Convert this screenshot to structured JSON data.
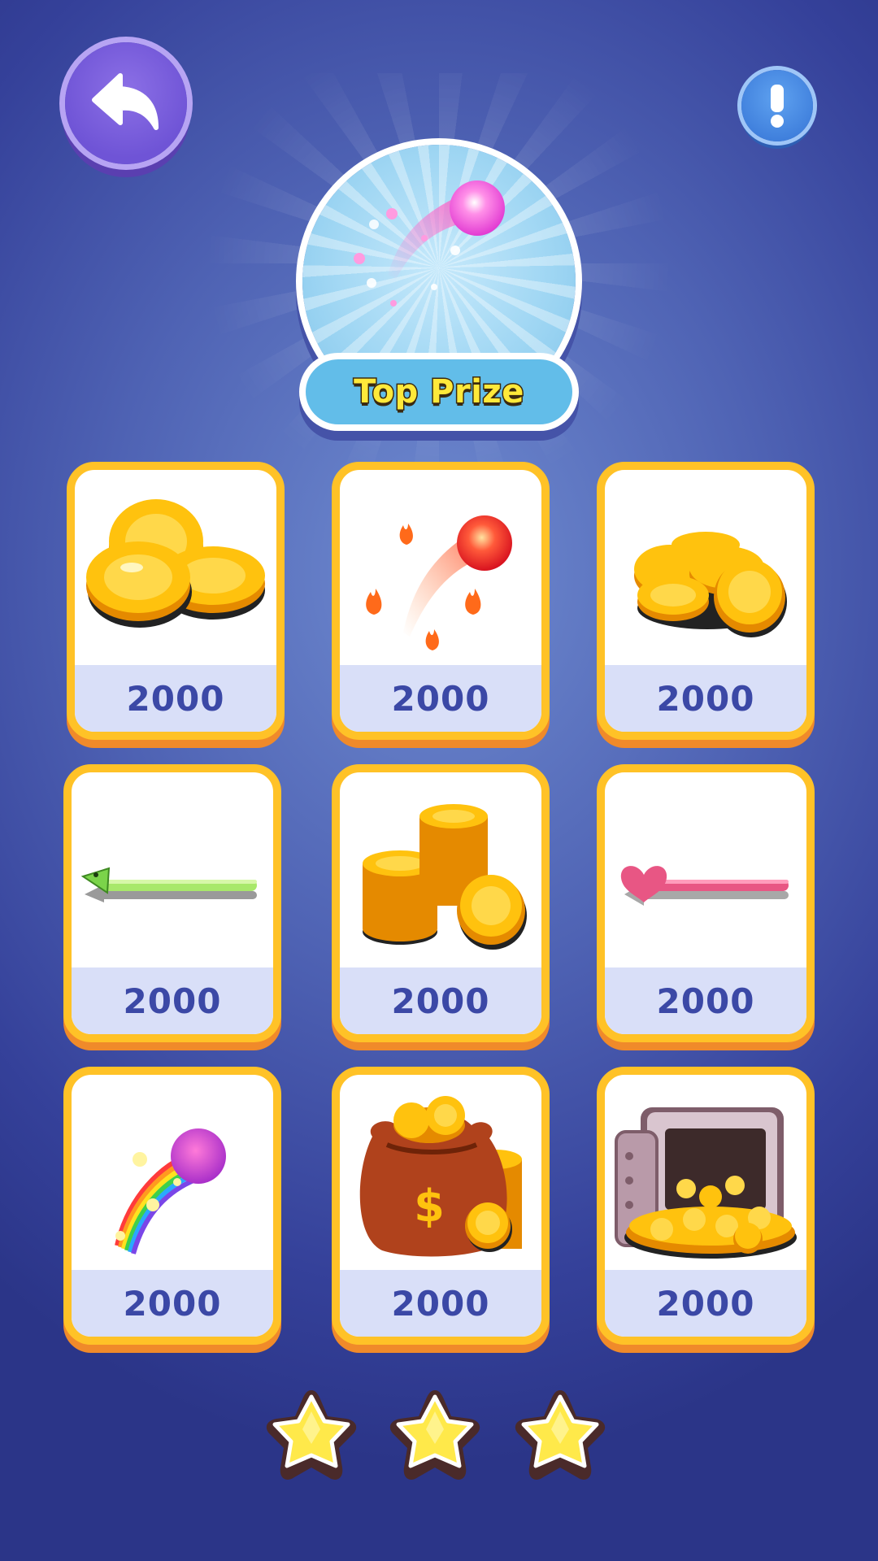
{
  "header": {
    "back_icon": "back-arrow-icon",
    "info_icon": "exclamation-icon"
  },
  "top_prize": {
    "label": "Top Prize",
    "item": "pink-comet-ball-trail"
  },
  "prizes": [
    {
      "item": "gold-coins-small",
      "price": "2000"
    },
    {
      "item": "fire-comet-ball-trail",
      "price": "2000"
    },
    {
      "item": "gold-coin-pile",
      "price": "2000"
    },
    {
      "item": "green-snake-stick",
      "price": "2000"
    },
    {
      "item": "gold-coin-stacks",
      "price": "2000"
    },
    {
      "item": "pink-heart-stick",
      "price": "2000"
    },
    {
      "item": "rainbow-comet-ball-trail",
      "price": "2000"
    },
    {
      "item": "money-bag-coins",
      "price": "2000"
    },
    {
      "item": "treasure-vault-coins",
      "price": "2000"
    }
  ],
  "stars": {
    "earned": 3,
    "total": 3
  },
  "colors": {
    "card_border": "#ffc227",
    "price_text": "#3b48a6",
    "top_prize_text": "#ffe93a",
    "back_button": "#6f54d6",
    "info_button": "#3f7fdc"
  }
}
